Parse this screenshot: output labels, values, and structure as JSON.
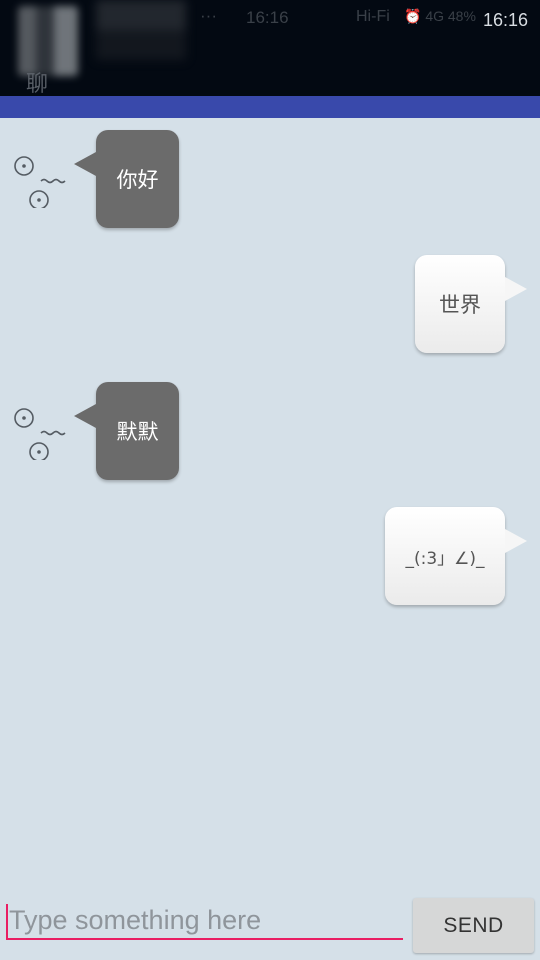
{
  "status_bar": {
    "dots": "···",
    "faded_time": "16:16",
    "network": "Hi-Fi",
    "indicators": "⏰ 4G 48%",
    "time": "16:16"
  },
  "header": {
    "title_glyph": "聊"
  },
  "colors": {
    "app_bar": "#3949ab",
    "chat_background": "#d5e0e8",
    "incoming_bubble": "#6b6b6b",
    "outgoing_bubble": "#f6f6f6",
    "input_accent": "#e91e63"
  },
  "messages": [
    {
      "direction": "incoming",
      "text": "你好"
    },
    {
      "direction": "outgoing",
      "text": "世界"
    },
    {
      "direction": "incoming",
      "text": "默默"
    },
    {
      "direction": "outgoing",
      "text": "_(:3」∠)_"
    }
  ],
  "input": {
    "value": "",
    "placeholder": "Type something here"
  },
  "send_button": {
    "label": "SEND"
  }
}
